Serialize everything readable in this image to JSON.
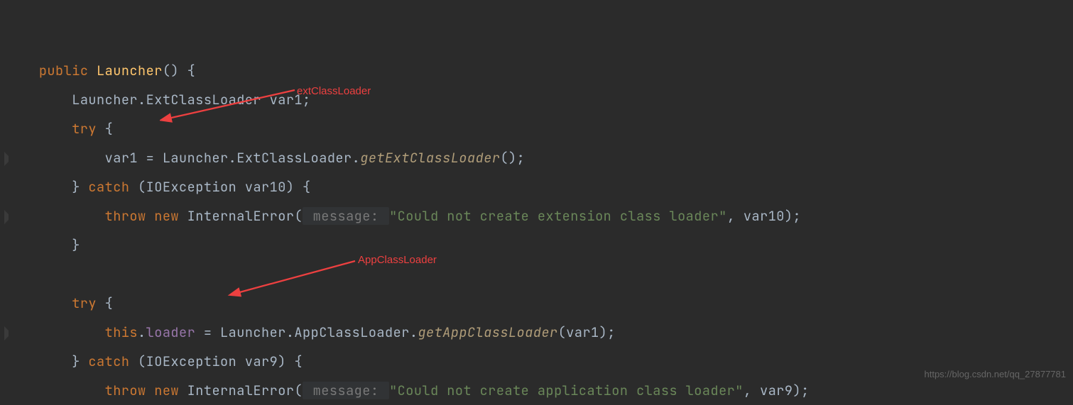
{
  "code": {
    "l1_kw_public": "public",
    "l1_fn": "Launcher",
    "l1_rest": "() {",
    "l2": "    Launcher.ExtClassLoader var1;",
    "l3_kw": "try",
    "l3_rest": " {",
    "l4_pre": "        var1 = Launcher.ExtClassLoader.",
    "l4_call": "getExtClassLoader",
    "l4_post": "();",
    "l5_brace": "    } ",
    "l5_kw": "catch",
    "l5_rest": " (IOException var10) {",
    "l6_kw1": "throw",
    "l6_kw2": "new",
    "l6_cls": " InternalError(",
    "l6_hint": " message: ",
    "l6_str": "\"Could not create extension class loader\"",
    "l6_post": ", var10);",
    "l7": "    }",
    "l8_kw": "try",
    "l8_rest": " {",
    "l9_kw": "this",
    "l9_dot": ".",
    "l9_var": "loader",
    "l9_mid": " = Launcher.AppClassLoader.",
    "l9_call": "getAppClassLoader",
    "l9_post": "(var1);",
    "l10_brace": "    } ",
    "l10_kw": "catch",
    "l10_rest": " (IOException var9) {",
    "l11_kw1": "throw",
    "l11_kw2": "new",
    "l11_cls": " InternalError(",
    "l11_hint": " message: ",
    "l11_str": "\"Could not create application class loader\"",
    "l11_post": ", var9);"
  },
  "annotations": {
    "a1": "extClassLoader",
    "a2": "AppClassLoader"
  },
  "watermark": "https://blog.csdn.net/qq_27877781"
}
